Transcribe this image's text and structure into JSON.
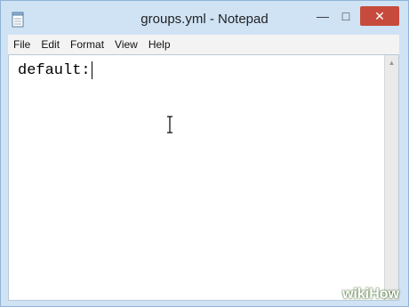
{
  "window": {
    "title": "groups.yml - Notepad",
    "controls": {
      "minimize": "—",
      "maximize": "□",
      "close": "✕"
    }
  },
  "menu": {
    "items": [
      "File",
      "Edit",
      "Format",
      "View",
      "Help"
    ]
  },
  "editor": {
    "content": "default:"
  },
  "icons": {
    "app": "notepad-icon",
    "cursor": "i-beam-cursor-icon"
  },
  "watermark": {
    "part1": "wiki",
    "part2": "How"
  },
  "colors": {
    "titlebar": "#cfe3f5",
    "close_button": "#c74b3c",
    "menubar": "#f3f3f3",
    "editor_bg": "#ffffff"
  }
}
